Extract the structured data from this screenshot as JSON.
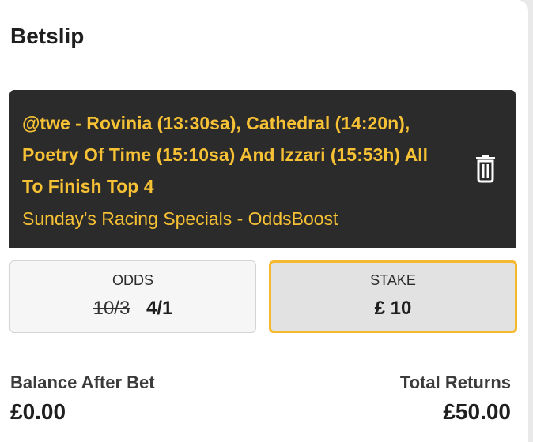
{
  "betslip": {
    "title": "Betslip",
    "bet": {
      "selection": "@twe - Rovinia (13:30sa), Cathedral (14:20n), Poetry Of Time (15:10sa) And Izzari (15:53h) All To Finish Top 4",
      "market": "Sunday's Racing Specials - OddsBoost",
      "delete_icon": "trash-icon"
    },
    "odds": {
      "label": "ODDS",
      "original": "10/3",
      "boosted": "4/1"
    },
    "stake": {
      "label": "STAKE",
      "value": "£ 10"
    },
    "summary": {
      "balance_label": "Balance After Bet",
      "balance_value": "£0.00",
      "returns_label": "Total Returns",
      "returns_value": "£50.00"
    }
  },
  "colors": {
    "card_background": "#2b2b2b",
    "accent_yellow": "#f7c135",
    "stake_border": "#f5b82e"
  }
}
